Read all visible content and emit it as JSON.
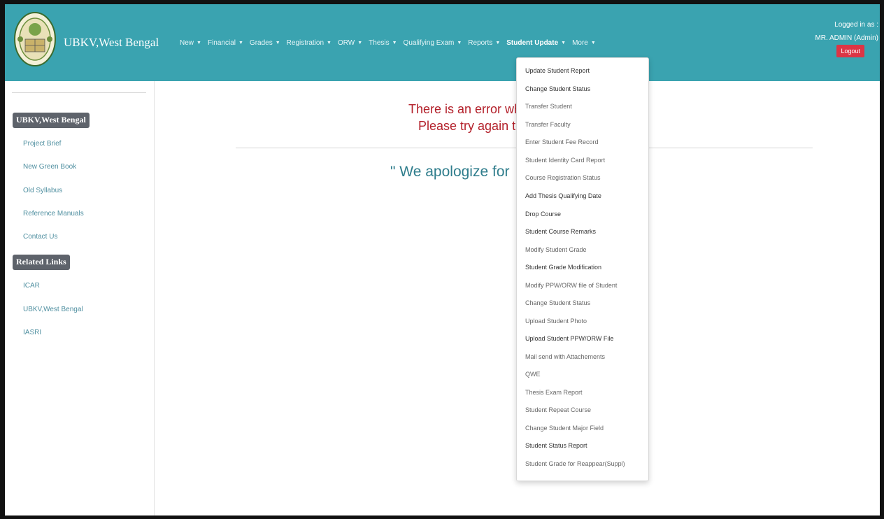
{
  "header": {
    "brand": "UBKV,West Bengal",
    "user_label": "Logged in as :",
    "user_name": "MR. ADMIN (Admin)",
    "logout_label": "Logout",
    "bg_color": "#3aa3b0"
  },
  "nav": [
    {
      "label": "New"
    },
    {
      "label": "Financial"
    },
    {
      "label": "Grades"
    },
    {
      "label": "Registration"
    },
    {
      "label": "ORW"
    },
    {
      "label": "Thesis"
    },
    {
      "label": "Qualifying Exam"
    },
    {
      "label": "Reports"
    },
    {
      "label": "Student Update"
    },
    {
      "label": "More"
    }
  ],
  "sidebar": {
    "section1": "UBKV,West Bengal",
    "links1": [
      "Project Brief",
      "New Green Book",
      "Old Syllabus",
      "Reference Manuals",
      "Contact Us"
    ],
    "section2": "Related Links",
    "links2": [
      "ICAR",
      "UBKV,West Bengal",
      "IASRI"
    ]
  },
  "main": {
    "error_line1": "There is an error wh",
    "error_line2": "Please try again to",
    "apology": "\" We apologize for"
  },
  "dropdown": {
    "items": [
      "Update Student Report",
      "Change Student Status",
      "Transfer Student",
      "Transfer Faculty",
      "Enter Student Fee Record",
      "Student Identity Card Report",
      "Course Registration Status",
      "Add Thesis Qualifying Date",
      "Drop Course",
      "Student Course Remarks",
      "Modify Student Grade",
      "Student Grade Modification",
      "Modify PPW/ORW file of Student",
      "Change Student Status",
      "Upload Student Photo",
      "Upload Student PPW/ORW File",
      "Mail send with Attachements",
      "QWE",
      "Thesis Exam Report",
      "Student Repeat Course",
      "Change Student Major Field",
      "Student Status Report",
      "Student Grade for Reappear(Suppl)"
    ]
  }
}
